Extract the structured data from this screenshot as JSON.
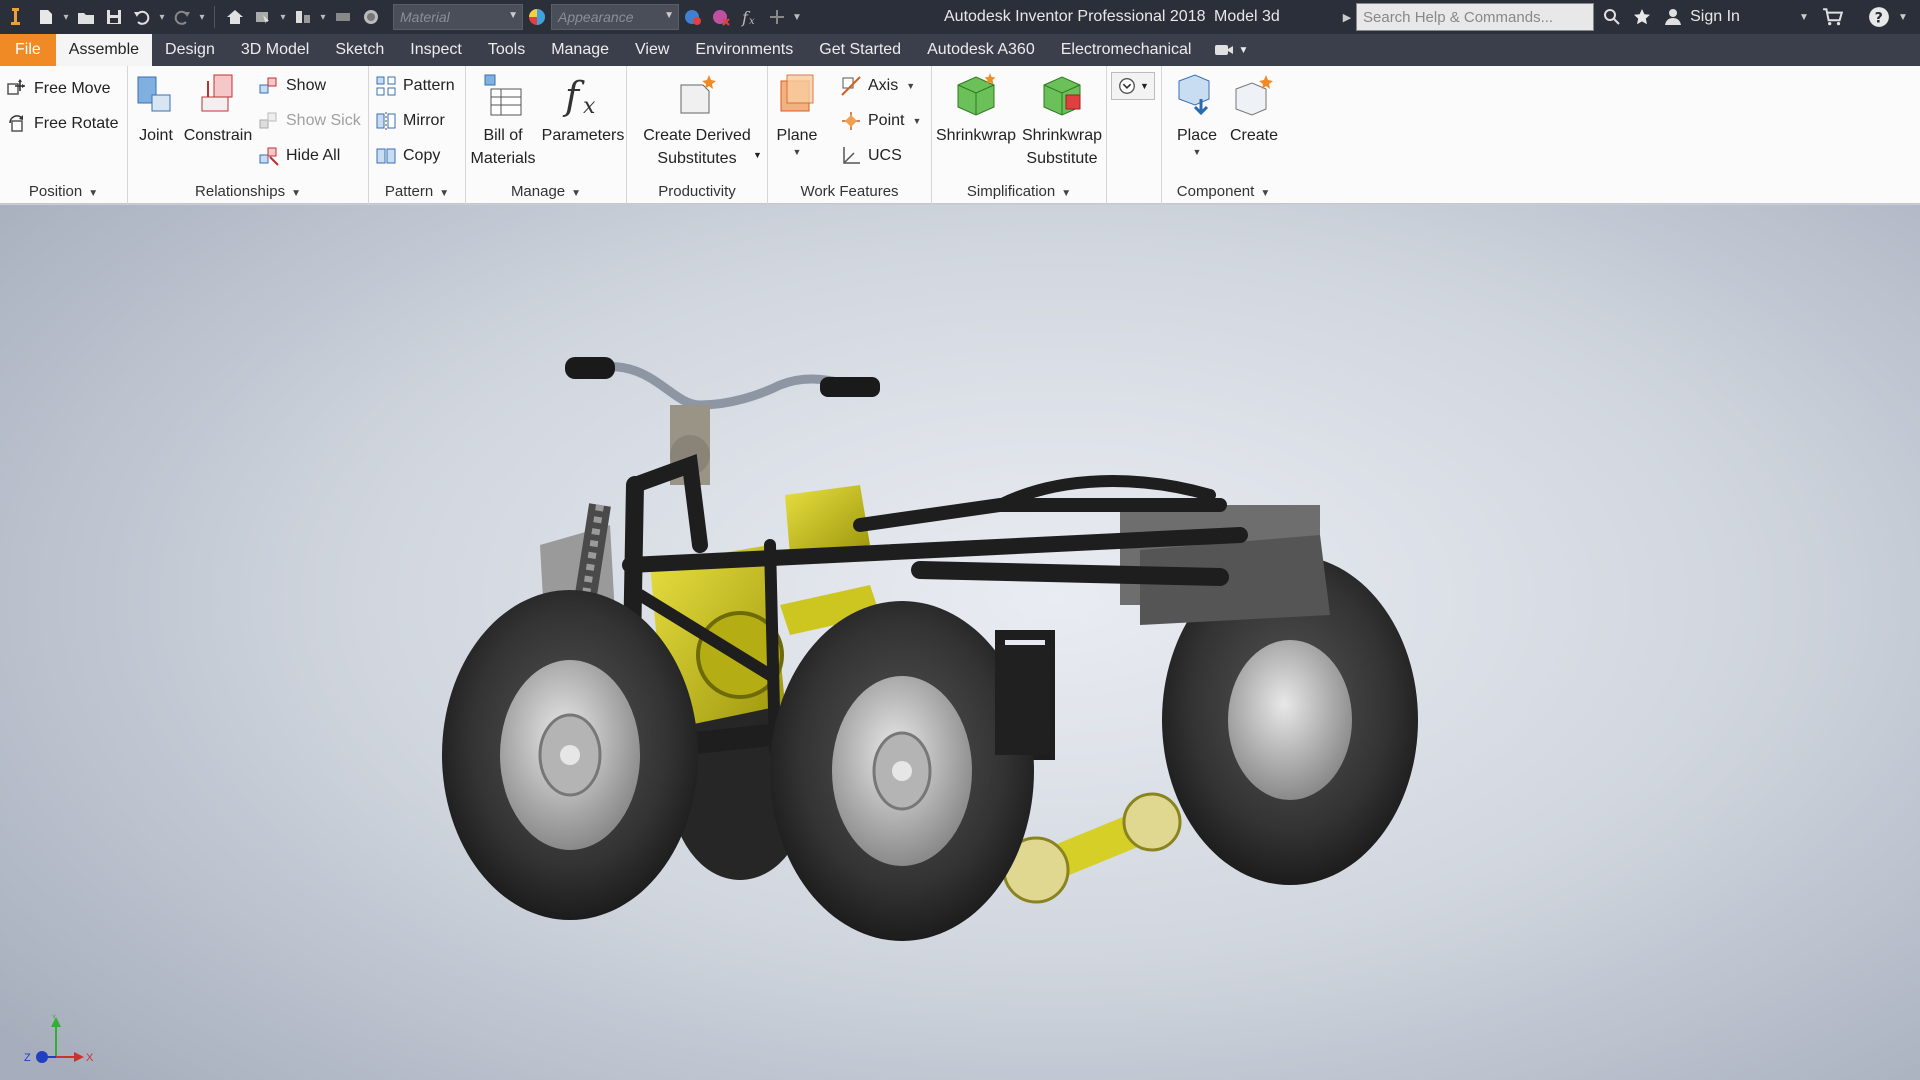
{
  "titlebar": {
    "material_placeholder": "Material",
    "appearance_placeholder": "Appearance",
    "app_title": "Autodesk Inventor Professional 2018",
    "document_title": "Model 3d",
    "search_placeholder": "Search Help & Commands...",
    "sign_in": "Sign In"
  },
  "tabs": [
    {
      "label": "File"
    },
    {
      "label": "Assemble"
    },
    {
      "label": "Design"
    },
    {
      "label": "3D Model"
    },
    {
      "label": "Sketch"
    },
    {
      "label": "Inspect"
    },
    {
      "label": "Tools"
    },
    {
      "label": "Manage"
    },
    {
      "label": "View"
    },
    {
      "label": "Environments"
    },
    {
      "label": "Get Started"
    },
    {
      "label": "Autodesk A360"
    },
    {
      "label": "Electromechanical"
    }
  ],
  "ribbon": {
    "position": {
      "label": "Position",
      "free_move": "Free Move",
      "free_rotate": "Free Rotate"
    },
    "relationships": {
      "label": "Relationships",
      "joint": "Joint",
      "constrain": "Constrain",
      "show": "Show",
      "show_sick": "Show Sick",
      "hide_all": "Hide All"
    },
    "pattern": {
      "label": "Pattern",
      "pattern": "Pattern",
      "mirror": "Mirror",
      "copy": "Copy"
    },
    "manage": {
      "label": "Manage",
      "bom_line1": "Bill of",
      "bom_line2": "Materials",
      "parameters": "Parameters"
    },
    "productivity": {
      "label": "Productivity",
      "create_derived_line1": "Create Derived",
      "create_derived_line2": "Substitutes"
    },
    "work_features": {
      "label": "Work Features",
      "plane": "Plane",
      "axis": "Axis",
      "point": "Point",
      "ucs": "UCS"
    },
    "simplification": {
      "label": "Simplification",
      "shrinkwrap": "Shrinkwrap",
      "shrinkwrap_sub_line1": "Shrinkwrap",
      "shrinkwrap_sub_line2": "Substitute"
    },
    "component": {
      "label": "Component",
      "place": "Place",
      "create": "Create"
    }
  },
  "viewport": {
    "axis_labels": {
      "x": "X",
      "y": "Y",
      "z": "Z"
    }
  },
  "colors": {
    "title_bg": "#2b2f3a",
    "tab_bg": "#3a3f4b",
    "file_tab": "#f08a24",
    "ribbon_bg": "#fbfbfb",
    "frame_yellow": "#c9c21c"
  }
}
